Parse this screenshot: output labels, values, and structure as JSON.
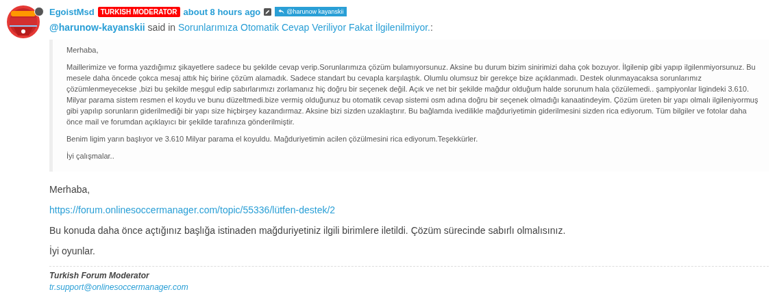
{
  "post": {
    "avatar": {
      "online": false
    },
    "author": "EgoistMsd",
    "role_badge": "TURKISH MODERATOR",
    "time": "about 8 hours ago",
    "edited": true,
    "reply_to": "@harunow kayanskii",
    "quote_header": {
      "user": "@harunow-kayanskii",
      "said_in": "said in",
      "topic": "Sorunlarımıza Otomatik Cevap Veriliyor Fakat İlgilenilmiyor.",
      "end": ":"
    },
    "quote": [
      "Merhaba,",
      "Maillerimize ve forma yazdığımız şikayetlere sadece bu şekilde cevap verip.Sorunlarımıza çözüm bulamıyorsunuz. Aksine bu durum bizim sinirimizi daha çok bozuyor. İlgilenip gibi yapıp ilgilenmiyorsunuz. Bu mesele daha öncede çokca mesaj attık hiç birine çözüm alamadık. Sadece standart bu cevapla karşılaştık. Olumlu olumsuz bir gerekçe bize açıklanmadı. Destek olunmayacaksa sorunlarımız çözümlenmeyecekse ,bizi bu şekilde meşgul edip sabırlarımızı zorlamanız hiç doğru bir seçenek değil. Açık ve net bir şekilde mağdur olduğum halde sorunum hala çözülemedi.. şampiyonlar ligindeki 3.610. Milyar parama sistem resmen el koydu ve bunu düzeltmedi.bize vermiş olduğunuz bu otomatik cevap sistemi osm adına doğru bir seçenek olmadığı kanaatindeyim. Çözüm üreten bir yapı olmalı ilgileniyormuş gibi yapılıp sorunların giderilmediği bir yapı size hiçbirşey kazandırmaz. Aksine bizi sizden uzaklaştırır. Bu bağlamda ivedilikle mağduriyetimin giderilmesini sizden rica ediyorum. Tüm bilgiler ve fotolar daha önce mail ve forumdan açıklayıcı bir şekilde tarafınıza gönderilmiştir.",
      "Benim ligim yarın başlıyor ve 3.610 Milyar parama el koyuldu. Mağduriyetimin acilen çözülmesini rica ediyorum.Teşekkürler.",
      "İyi çalışmalar.."
    ],
    "body": [
      {
        "kind": "text",
        "text": "Merhaba,"
      },
      {
        "kind": "link",
        "text": "https://forum.onlinesoccermanager.com/topic/55336/lütfen-destek/2"
      },
      {
        "kind": "text",
        "text": "Bu konuda daha önce açtığınız başlığa istinaden mağduriyetiniz ilgili birimlere iletildi. Çözüm sürecinde sabırlı olmalısınız."
      },
      {
        "kind": "text",
        "text": "İyi oyunlar."
      }
    ],
    "signature": {
      "title": "Turkish Forum Moderator",
      "email": "tr.support@onlinesoccermanager.com"
    }
  }
}
